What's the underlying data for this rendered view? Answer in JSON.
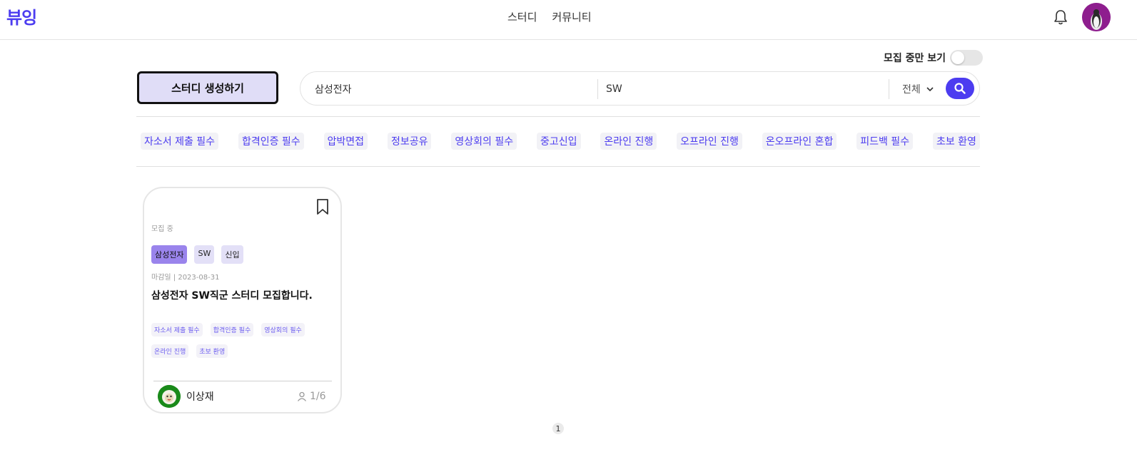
{
  "header": {
    "logo": "뷰잉",
    "nav": [
      "스터디",
      "커뮤니티"
    ],
    "icons": {
      "notification": "bell-icon",
      "profile": "user-avatar"
    }
  },
  "filters": {
    "recruiting_only_label": "모집 중만 보기",
    "recruiting_only_on": false
  },
  "create_button_label": "스터디 생성하기",
  "search": {
    "company_value": "삼성전자",
    "job_value": "SW",
    "category_selected": "전체",
    "icon": "search-icon"
  },
  "tags": [
    "자소서 제출 필수",
    "합격인증 필수",
    "압박면접",
    "정보공유",
    "영상회의 필수",
    "중고신입",
    "온라인 진행",
    "오프라인 진행",
    "온오프라인 혼합",
    "피드백 필수",
    "초보 환영"
  ],
  "colors": {
    "accent": "#4c3cf0",
    "badge_primary": "#9a84ec",
    "badge": "#e3e0f7",
    "create_button_bg": "#e0ddf7"
  },
  "study_card": {
    "status": "모집 중",
    "badges": [
      "삼성전자",
      "SW",
      "신입"
    ],
    "deadline": "마감일 | 2023-08-31",
    "title": "삼성전자 SW직군 스터디 모집합니다.",
    "tags": [
      "자소서 제출 필수",
      "합격인증 필수",
      "영상회의 필수",
      "온라인 진행",
      "초보 환영"
    ],
    "author": "이상재",
    "members": "1/6"
  },
  "pagination": {
    "current": "1"
  }
}
